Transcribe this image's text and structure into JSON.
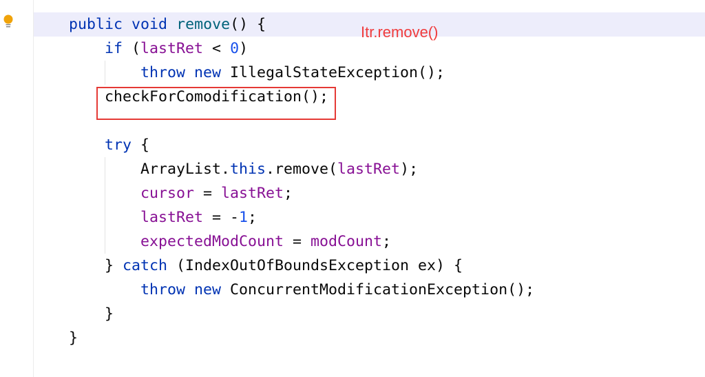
{
  "annotation": "Itr.remove()",
  "colors": {
    "keyword": "#0033b3",
    "field": "#871094",
    "number": "#1750eb",
    "method": "#00627a",
    "highlight_box": "#e53935"
  },
  "lines": [
    {
      "indent": 1,
      "tokens": [
        [
          "public",
          "kw"
        ],
        [
          " ",
          "pl"
        ],
        [
          "void",
          "kw"
        ],
        [
          " ",
          "pl"
        ],
        [
          "remove",
          "fn"
        ],
        [
          "() {",
          "pl"
        ]
      ]
    },
    {
      "indent": 2,
      "tokens": [
        [
          "if",
          "kw"
        ],
        [
          " (",
          "pl"
        ],
        [
          "lastRet",
          "fld"
        ],
        [
          " < ",
          "pl"
        ],
        [
          "0",
          "num"
        ],
        [
          ")",
          "pl"
        ]
      ]
    },
    {
      "indent": 3,
      "tokens": [
        [
          "throw",
          "kw"
        ],
        [
          " ",
          "pl"
        ],
        [
          "new",
          "kw"
        ],
        [
          " IllegalStateException();",
          "pl"
        ]
      ]
    },
    {
      "indent": 2,
      "tokens": [
        [
          "checkForComodification();",
          "pl"
        ]
      ]
    },
    {
      "indent": 0,
      "tokens": []
    },
    {
      "indent": 2,
      "tokens": [
        [
          "try",
          "kw"
        ],
        [
          " {",
          "pl"
        ]
      ]
    },
    {
      "indent": 3,
      "tokens": [
        [
          "ArrayList.",
          "pl"
        ],
        [
          "this",
          "kw"
        ],
        [
          ".remove(",
          "pl"
        ],
        [
          "lastRet",
          "fld"
        ],
        [
          ");",
          "pl"
        ]
      ]
    },
    {
      "indent": 3,
      "tokens": [
        [
          "cursor",
          "fld"
        ],
        [
          " = ",
          "pl"
        ],
        [
          "lastRet",
          "fld"
        ],
        [
          ";",
          "pl"
        ]
      ]
    },
    {
      "indent": 3,
      "tokens": [
        [
          "lastRet",
          "fld"
        ],
        [
          " = -",
          "pl"
        ],
        [
          "1",
          "num"
        ],
        [
          ";",
          "pl"
        ]
      ]
    },
    {
      "indent": 3,
      "tokens": [
        [
          "expectedModCount",
          "fld"
        ],
        [
          " = ",
          "pl"
        ],
        [
          "modCount",
          "fld"
        ],
        [
          ";",
          "pl"
        ]
      ]
    },
    {
      "indent": 2,
      "tokens": [
        [
          "} ",
          "pl"
        ],
        [
          "catch",
          "kw"
        ],
        [
          " (IndexOutOfBoundsException ex) {",
          "pl"
        ]
      ]
    },
    {
      "indent": 3,
      "tokens": [
        [
          "throw",
          "kw"
        ],
        [
          " ",
          "pl"
        ],
        [
          "new",
          "kw"
        ],
        [
          " ConcurrentModificationException();",
          "pl"
        ]
      ]
    },
    {
      "indent": 2,
      "tokens": [
        [
          "}",
          "pl"
        ]
      ]
    },
    {
      "indent": 1,
      "tokens": [
        [
          "}",
          "pl"
        ]
      ]
    }
  ]
}
